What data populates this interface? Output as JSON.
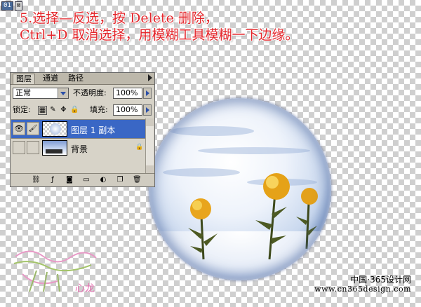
{
  "window": {
    "number": "01",
    "close": "⊠"
  },
  "instruction": {
    "line1": "5.选择—反选，按 Delete 删除，",
    "line2": "Ctrl+D 取消选择，用模糊工具模糊一下边缘。"
  },
  "layers_panel": {
    "tabs": [
      "图层",
      "通道",
      "路径"
    ],
    "blend_mode": "正常",
    "opacity_label": "不透明度:",
    "opacity_value": "100%",
    "lock_label": "锁定:",
    "fill_label": "填充:",
    "fill_value": "100%",
    "layers": [
      {
        "name": "图层 1 副本",
        "selected": true,
        "visible": true
      },
      {
        "name": "背景",
        "selected": false,
        "visible": false,
        "locked": true
      }
    ],
    "bottom_icons": [
      "link-layers-icon",
      "layer-style-icon",
      "add-mask-icon",
      "new-group-icon",
      "adjustment-layer-icon",
      "new-layer-icon",
      "delete-layer-icon"
    ]
  },
  "watermark": {
    "logo_text": "心龙",
    "site_name": "中国·365设计网",
    "site_url": "www.cn365design.com"
  },
  "colors": {
    "accent_red": "#e3262b",
    "selected_layer": "#3a67c5"
  }
}
